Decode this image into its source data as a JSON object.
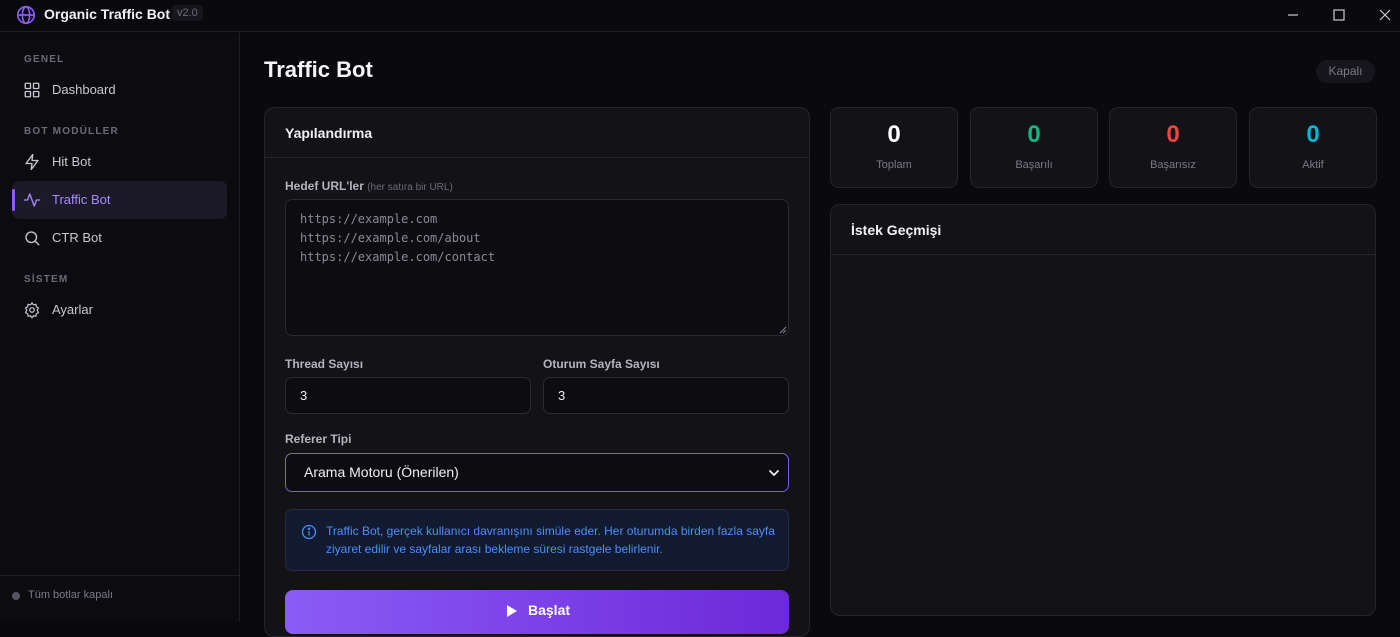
{
  "app": {
    "title": "Organic Traffic Bot",
    "version": "v2.0",
    "logo_icon": "globe-icon",
    "accent_color": "#8b5cf6"
  },
  "window_controls": [
    "minimize-icon",
    "maximize-icon",
    "close-icon"
  ],
  "sidebar": {
    "sections": [
      {
        "label": "GENEL",
        "items": [
          {
            "label": "Dashboard",
            "icon": "grid-icon",
            "active": false
          }
        ]
      },
      {
        "label": "BOT MODÜLLER",
        "items": [
          {
            "label": "Hit Bot",
            "icon": "lightning-icon",
            "active": false
          },
          {
            "label": "Traffic Bot",
            "icon": "activity-icon",
            "active": true
          },
          {
            "label": "CTR Bot",
            "icon": "search-icon",
            "active": false
          }
        ]
      },
      {
        "label": "SİSTEM",
        "items": [
          {
            "label": "Ayarlar",
            "icon": "gear-icon",
            "active": false
          }
        ]
      }
    ],
    "footer_status": "Tüm botlar kapalı"
  },
  "page": {
    "title": "Traffic Bot",
    "status_badge": "Kapalı"
  },
  "config": {
    "title": "Yapılandırma",
    "urls_label": "Hedef URL'ler",
    "urls_hint": "(her satıra bir URL)",
    "urls_placeholder": "https://example.com\nhttps://example.com/about\nhttps://example.com/contact",
    "thread_label": "Thread Sayısı",
    "thread_value": "3",
    "session_pages_label": "Oturum Sayfa Sayısı",
    "session_pages_value": "3",
    "referer_label": "Referer Tipi",
    "referer_value": "Arama Motoru (Önerilen)",
    "info_text": "Traffic Bot, gerçek kullanıcı davranışını simüle eder. Her oturumda birden fazla sayfa ziyaret edilir ve sayfalar arası bekleme süresi rastgele belirlenir.",
    "start_label": "Başlat"
  },
  "stats": [
    {
      "value": "0",
      "label": "Toplam",
      "color": "#ffffff"
    },
    {
      "value": "0",
      "label": "Başarılı",
      "color": "#10b981"
    },
    {
      "value": "0",
      "label": "Başarısız",
      "color": "#ef4444"
    },
    {
      "value": "0",
      "label": "Aktif",
      "color": "#06b6d4"
    }
  ],
  "history": {
    "title": "İstek Geçmişi"
  }
}
